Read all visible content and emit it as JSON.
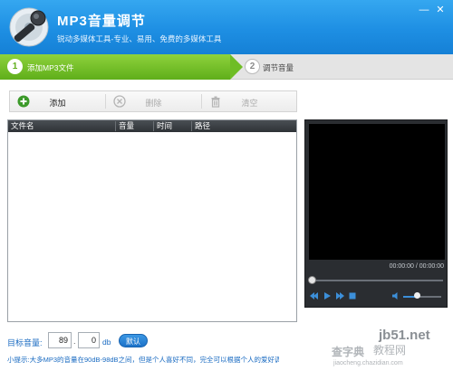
{
  "header": {
    "title": "MP3音量调节",
    "subtitle": "锐动多媒体工具-专业、易用、免费的多媒体工具",
    "minimize_glyph": "—",
    "close_glyph": "✕",
    "accent": "#1e8fe3"
  },
  "steps": [
    {
      "number": "1",
      "label": "添加MP3文件",
      "active": true
    },
    {
      "number": "2",
      "label": "调节音量",
      "active": false
    }
  ],
  "toolbar": {
    "add_label": "添加",
    "delete_label": "删除",
    "clear_label": "清空",
    "icons": [
      "plus-circle-icon",
      "x-circle-icon",
      "trash-icon"
    ]
  },
  "file_table": {
    "columns": [
      "文件名",
      "音量",
      "时间",
      "路径"
    ],
    "rows": []
  },
  "player": {
    "timecode": "00:00:00 / 00:00:00",
    "seek_position": 0,
    "volume_level": 0.35
  },
  "target_volume": {
    "label": "目标音量:",
    "integer_value": "89",
    "decimal_separator": ".",
    "fraction_value": "0",
    "unit": "db",
    "default_button": "默认"
  },
  "tip": "小提示:大多MP3的音量在90dB-98dB之间，但是个人喜好不同，完全可以根据个人的爱好调",
  "watermark": {
    "site": "jb51.net",
    "brand_a": "查字典",
    "brand_b": "教程网",
    "url": "jiaocheng.chazidian.com"
  },
  "colors": {
    "step_active": "#6fbd25",
    "link_blue": "#1a6bc2",
    "player_bg": "#2a2d31"
  }
}
